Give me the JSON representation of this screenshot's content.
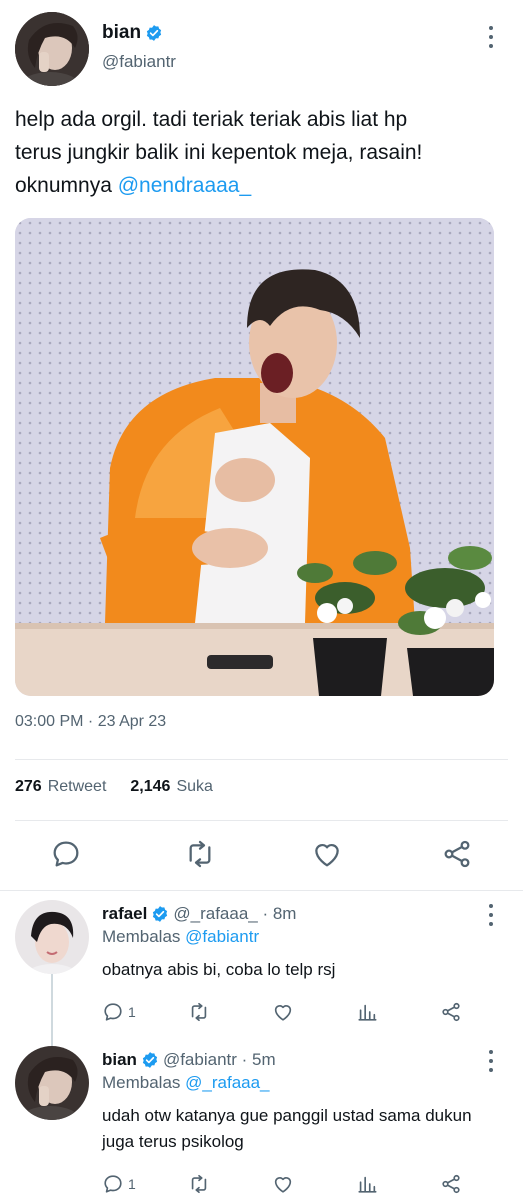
{
  "tweet": {
    "author_name": "bian",
    "author_handle": "@fabiantr",
    "text_line1": "help ada orgil. tadi teriak teriak abis liat hp",
    "text_line2": "terus jungkir balik ini kepentok meja, rasain!",
    "text_line3_prefix": "oknumnya ",
    "mention": "@nendraaaa_",
    "time": "03:00 PM",
    "date_sep": " · ",
    "date": "23 Apr 23",
    "retweet_count": "276",
    "retweet_label": "Retweet",
    "like_count": "2,146",
    "like_label": "Suka"
  },
  "replies": [
    {
      "name": "rafael",
      "handle_time": "@_rafaaa_ · 8m",
      "replying_label": "Membalas ",
      "replying_to": "@fabiantr",
      "text": "obatnya abis bi, coba lo telp rsj",
      "reply_count": "1"
    },
    {
      "name": "bian",
      "handle_time": "@fabiantr · 5m",
      "replying_label": "Membalas ",
      "replying_to": "@_rafaaa_",
      "text_line1": "udah otw katanya gue panggil ustad sama dukun",
      "text_line2": "juga terus psikolog",
      "reply_count": "1"
    }
  ],
  "colors": {
    "accent": "#1d9bf0",
    "secondary_text": "#536471",
    "primary_text": "#0f1419",
    "divider": "#e7e9ec",
    "shirt": "#f28a1c"
  },
  "icons": [
    "verified-badge-icon",
    "more-options-icon",
    "reply-icon",
    "retweet-icon",
    "like-icon",
    "share-icon",
    "analytics-icon"
  ]
}
